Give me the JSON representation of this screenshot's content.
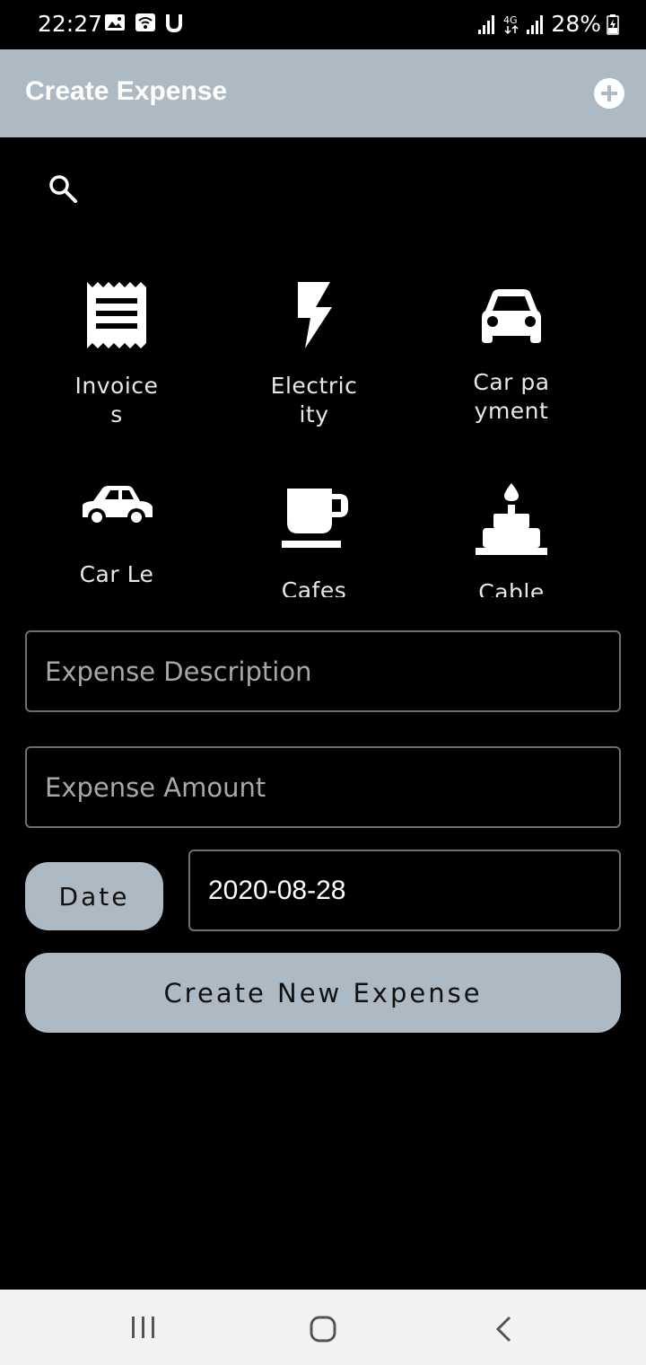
{
  "status_bar": {
    "time": "22:27",
    "battery": "28%",
    "left_icons": [
      "image-icon",
      "wifi-calling-icon",
      "u-icon"
    ],
    "right_icons": [
      "signal-icon",
      "4g-icon",
      "signal-icon",
      "battery-charging-icon"
    ]
  },
  "app_bar": {
    "title": "Create Expense",
    "add_icon": "add-circle-icon",
    "color": "#aebac3"
  },
  "search": {
    "icon": "search-icon"
  },
  "categories": [
    {
      "label": "Invoices",
      "icon": "receipt-icon"
    },
    {
      "label": "Electricity",
      "icon": "bolt-icon"
    },
    {
      "label": "Car payment",
      "icon": "car-front-icon"
    },
    {
      "label": "Car Le",
      "icon": "car-side-icon"
    },
    {
      "label": "Cafes",
      "icon": "coffee-cup-icon"
    },
    {
      "label": "Cable",
      "icon": "cake-icon"
    }
  ],
  "form": {
    "description_placeholder": "Expense Description",
    "amount_placeholder": "Expense Amount",
    "date_button": "Date",
    "date_value": "2020-08-28",
    "submit_button": "Create New Expense"
  },
  "nav_bar": {
    "icons": [
      "recents-icon",
      "home-icon",
      "back-icon"
    ]
  }
}
